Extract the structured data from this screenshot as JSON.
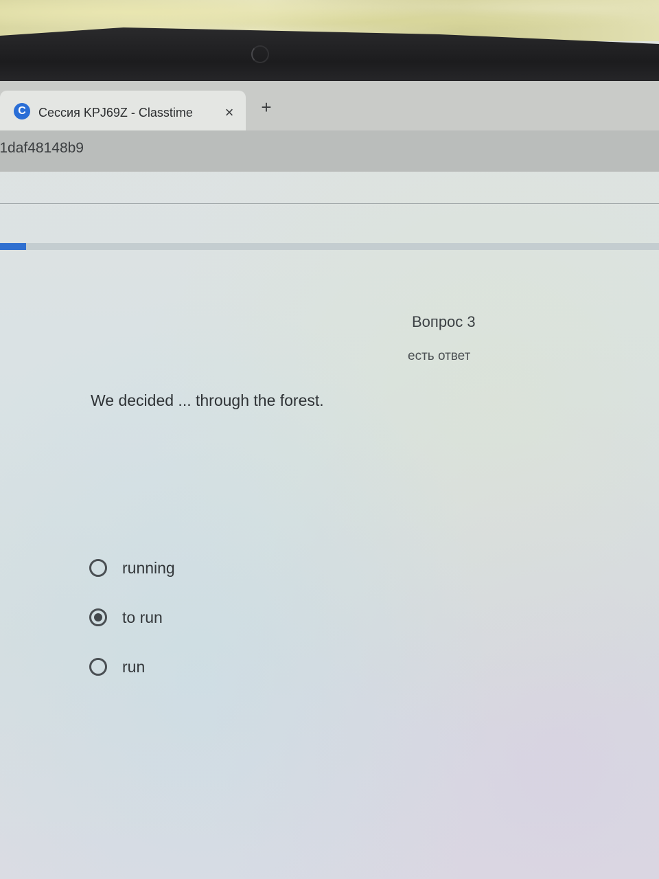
{
  "browser": {
    "tab": {
      "favicon_letter": "C",
      "title": "Сессия KPJ69Z - Classtime",
      "close_glyph": "×"
    },
    "new_tab_glyph": "+",
    "url": "1daf48148b9"
  },
  "quiz": {
    "progress_fraction": 0.04,
    "question_number": "Вопрос 3",
    "answer_status": "есть ответ",
    "question_text": "We decided ... through the forest.",
    "options": [
      {
        "label": "running",
        "selected": false
      },
      {
        "label": "to run",
        "selected": true
      },
      {
        "label": "run",
        "selected": false
      }
    ]
  },
  "colors": {
    "accent": "#2f6fd0",
    "favicon": "#2a6ed6"
  },
  "icons": {
    "favicon": "classtime-logo-icon",
    "close": "close-icon",
    "new_tab": "plus-icon",
    "radio": "radio-icon"
  }
}
